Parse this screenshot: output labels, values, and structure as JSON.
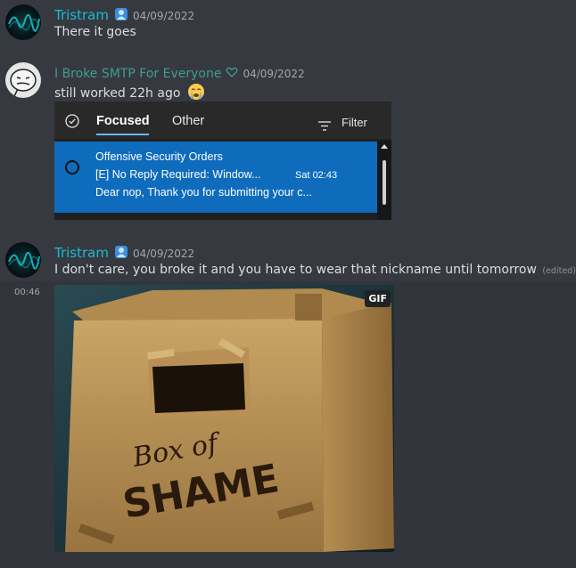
{
  "messages": [
    {
      "author": "Tristram",
      "timestamp": "04/09/2022",
      "text": "There it goes"
    },
    {
      "author": "I Broke SMTP For Everyone",
      "timestamp": "04/09/2022",
      "text": "still worked 22h ago",
      "emoji": "sob-emoji",
      "embed": {
        "tabs": [
          "Focused",
          "Other"
        ],
        "filter_label": "Filter",
        "email": {
          "sender": "Offensive Security Orders",
          "subject": "[E] No Reply Required: Window...",
          "date": "Sat 02:43",
          "preview": "Dear nop, Thank you for submitting your c..."
        }
      }
    },
    {
      "author": "Tristram",
      "timestamp": "04/09/2022",
      "text": "I don't care, you broke it and you have to wear that nickname until tomorrow",
      "edited_label": "(edited)",
      "side_time": "00:46",
      "gif": {
        "badge": "GIF",
        "image_text_line1": "Box of",
        "image_text_line2": "SHAME"
      }
    }
  ],
  "colors": {
    "background": "#36393f",
    "tristram_name": "#1abcd1",
    "smtp_name": "#3e9d8f",
    "outlook_selected": "#0f6cbd"
  },
  "icons": {
    "badge": "person-badge-icon",
    "smtp_emoji": "heart-outline-icon",
    "tab_check": "check-circle-icon",
    "filter": "filter-lines-icon"
  }
}
